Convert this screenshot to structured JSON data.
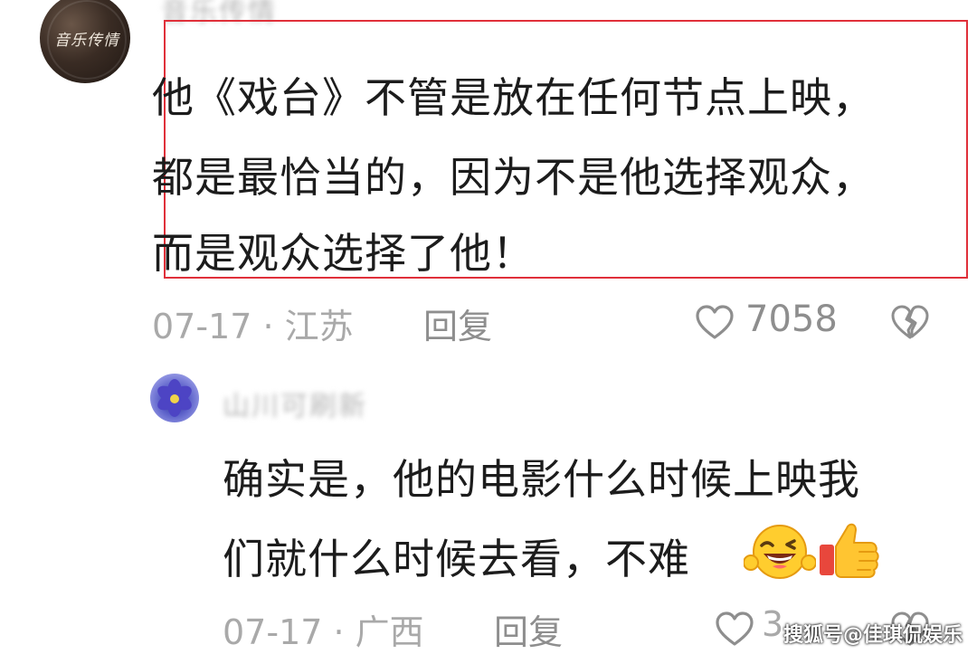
{
  "comments": [
    {
      "avatar_text": "音乐传情",
      "username": "音乐传情",
      "lines": [
        "他《戏台》不管是放在任何节点上映，",
        "都是最恰当的，因为不是他选择观众，",
        "而是观众选择了他！"
      ],
      "date_location": "07-17 · 江苏",
      "reply_label": "回复",
      "like_count": "7058"
    },
    {
      "username": "山川可刷新",
      "lines": [
        "确实是，他的电影什么时候上映我",
        "们就什么时候去看，不难"
      ],
      "date_location": "07-17 · 广西",
      "reply_label": "回复",
      "like_count_partial": "3"
    }
  ],
  "icons": {
    "like": "heart-outline-icon",
    "dislike": "broken-heart-icon",
    "emoji_1": "grinning-wink-emoji",
    "emoji_2": "thumbs-up-emoji"
  },
  "colors": {
    "highlight": "#e0303a",
    "text": "#1c1c1c",
    "meta": "#a9a9a9"
  },
  "watermark": "搜狐号@佳琪侃娱乐"
}
